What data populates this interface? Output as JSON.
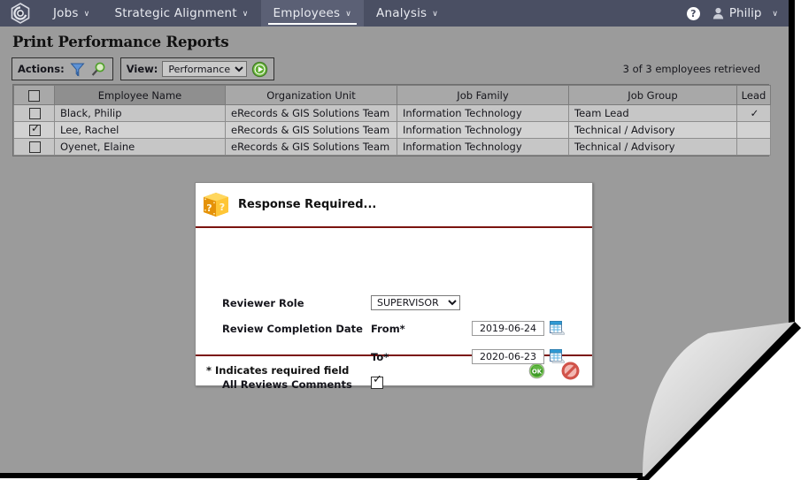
{
  "nav": {
    "logo_icon": "hexagon-logo-icon",
    "items": [
      {
        "label": "Jobs",
        "active": false
      },
      {
        "label": "Strategic Alignment",
        "active": false
      },
      {
        "label": "Employees",
        "active": true
      },
      {
        "label": "Analysis",
        "active": false
      }
    ],
    "help_icon": "help-question-icon",
    "help_label": "?",
    "user_icon": "user-avatar-icon",
    "user_label": "Philip",
    "caret": "∨"
  },
  "page": {
    "title": "Print Performance Reports",
    "retrieved_text": "3 of 3 employees retrieved"
  },
  "toolbar": {
    "actions_label": "Actions:",
    "filter_icon": "filter-funnel-icon",
    "search_icon": "magnifier-search-icon",
    "view_label": "View:",
    "view_value": "Performance",
    "view_options": [
      "Performance"
    ],
    "go_icon": "go-play-icon"
  },
  "grid": {
    "columns": [
      "Employee Name",
      "Organization Unit",
      "Job Family",
      "Job Group",
      "Lead"
    ],
    "sorted_column": "Employee Name",
    "header_checkbox_checked": false,
    "rows": [
      {
        "selected": false,
        "checked": false,
        "name": "Black, Philip",
        "org_unit": "eRecords & GIS Solutions Team",
        "job_family": "Information Technology",
        "job_group": "Team Lead",
        "lead": "✓"
      },
      {
        "selected": true,
        "checked": true,
        "name": "Lee, Rachel",
        "org_unit": "eRecords & GIS Solutions Team",
        "job_family": "Information Technology",
        "job_group": "Technical / Advisory",
        "lead": ""
      },
      {
        "selected": false,
        "checked": false,
        "name": "Oyenet, Elaine",
        "org_unit": "eRecords & GIS Solutions Team",
        "job_family": "Information Technology",
        "job_group": "Technical / Advisory",
        "lead": ""
      }
    ]
  },
  "dialog": {
    "icon": "question-cube-icon",
    "title": "Response Required...",
    "fields": {
      "reviewer_role_label": "Reviewer Role",
      "reviewer_role_value": "SUPERVISOR",
      "reviewer_role_options": [
        "SUPERVISOR"
      ],
      "review_completion_label": "Review Completion Date",
      "from_label": "From*",
      "from_value": "2019-06-24",
      "to_label": "To*",
      "to_value": "2020-06-23",
      "calendar_icon": "calendar-picker-icon",
      "all_reviews_label": "All Reviews Comments",
      "all_reviews_checked": true
    },
    "footer": {
      "required_note": "* Indicates required field",
      "ok_icon": "ok-confirm-icon",
      "ok_label": "OK",
      "cancel_icon": "cancel-deny-icon"
    }
  },
  "colors": {
    "nav_bg": "#4a4f63",
    "nav_active_bg": "#5b6075",
    "page_bg": "#9b9b9b",
    "grid_header_bg": "#a8a8a8",
    "grid_sorted_bg": "#8f8f8f",
    "grid_row_bg": "#c6c6c6",
    "grid_row_selected_bg": "#d2d2d2",
    "dialog_rule": "#7b1410",
    "ok_green": "#3f9b28",
    "cancel_red": "#d1534a"
  }
}
